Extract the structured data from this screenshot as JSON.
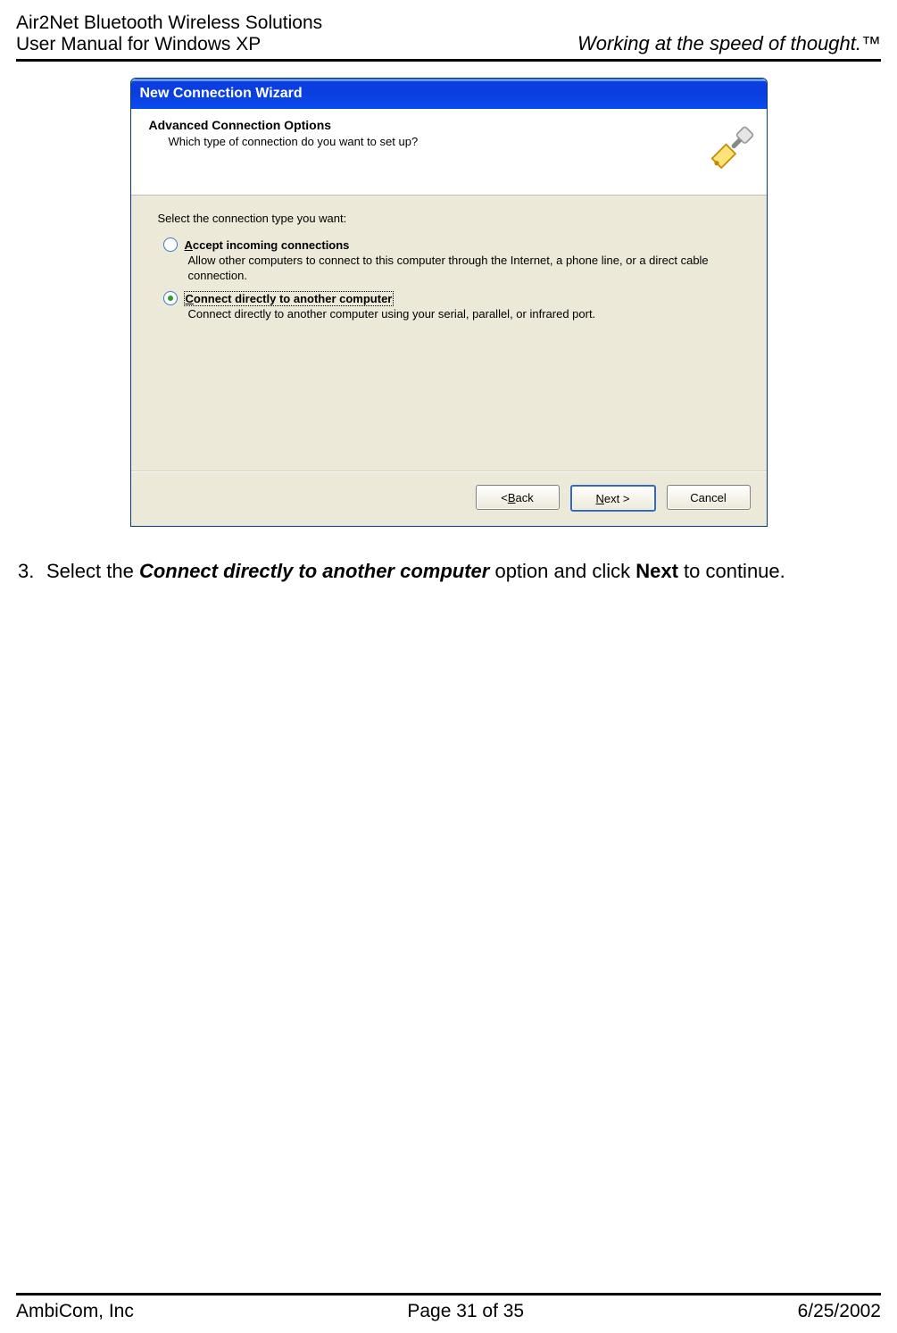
{
  "header": {
    "left_line1": "Air2Net Bluetooth Wireless Solutions",
    "left_line2": "User Manual for Windows XP",
    "right": "Working at the speed of thought.™"
  },
  "dialog": {
    "title": "New Connection Wizard",
    "panel_title": "Advanced Connection Options",
    "panel_sub": "Which type of connection do you want to set up?",
    "instruction": "Select the connection type you want:",
    "options": [
      {
        "accel": "A",
        "rest": "ccept incoming connections",
        "desc": "Allow other computers to connect to this computer through the Internet, a phone line, or a direct cable connection.",
        "selected": false
      },
      {
        "accel": "C",
        "rest": "onnect directly to another computer",
        "desc": "Connect directly to another computer using your serial, parallel, or infrared port.",
        "selected": true
      }
    ],
    "buttons": {
      "back_pre": "< ",
      "back_accel": "B",
      "back_rest": "ack",
      "next_accel": "N",
      "next_rest": "ext >",
      "cancel": "Cancel"
    }
  },
  "step": {
    "number": "3.",
    "pre": "Select the ",
    "bold_italic": "Connect directly to another computer",
    "mid": " option and click ",
    "bold": "Next",
    "post": " to continue."
  },
  "footer": {
    "left": "AmbiCom, Inc",
    "center": "Page 31 of 35",
    "right": "6/25/2002"
  }
}
